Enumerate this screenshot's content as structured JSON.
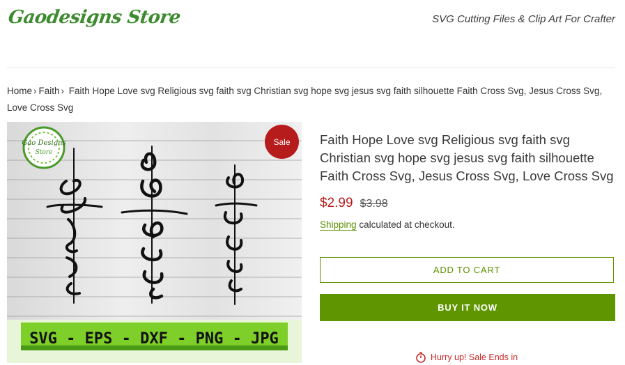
{
  "header": {
    "logo_text": "Gaodesigns Store",
    "tagline": "SVG Cutting Files & Clip Art For Crafter"
  },
  "breadcrumb": {
    "home": "Home",
    "separator": "›",
    "category": "Faith",
    "current": "Faith Hope Love svg Religious svg faith svg Christian svg hope svg jesus svg faith silhouette Faith Cross Svg, Jesus Cross Svg, Love Cross Svg"
  },
  "product_image": {
    "words": [
      "faith",
      "hope",
      "love"
    ],
    "formats_banner": "SVG - EPS - DXF - PNG - JPG",
    "watermark": "Gao Designs Store"
  },
  "sale_badge": "Sale",
  "product": {
    "title": "Faith Hope Love svg Religious svg faith svg Christian svg hope svg jesus svg faith silhouette Faith Cross Svg, Jesus Cross Svg, Love Cross Svg",
    "sale_price": "$2.99",
    "compare_price": "$3.98",
    "shipping_link": "Shipping",
    "shipping_note": "calculated at checkout."
  },
  "buttons": {
    "add_to_cart": "ADD TO CART",
    "buy_now": "BUY IT NOW"
  },
  "urgency": {
    "text": "Hurry up! Sale Ends in",
    "icon": "stopwatch-icon"
  },
  "colors": {
    "brand_green": "#5f9600",
    "sale_red": "#b71c1c",
    "logo_green": "#3d8b2f"
  }
}
